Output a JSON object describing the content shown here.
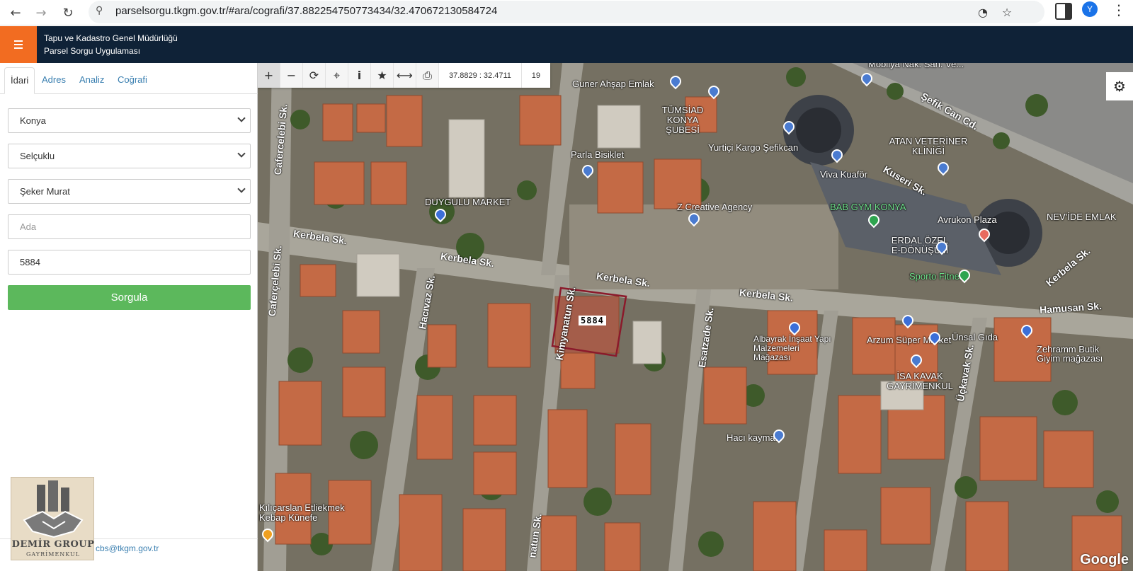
{
  "browser": {
    "url": "parselsorgu.tkgm.gov.tr/#ara/cografi/37.882254750773434/32.470672130584724",
    "back_icon": "←",
    "forward_icon": "→",
    "reload_icon": "↻",
    "site_info_icon": "⚲",
    "gauge_icon": "◔",
    "star_icon": "☆",
    "avatar_letter": "Y",
    "more_icon": "⋮"
  },
  "app": {
    "title_line1": "Tapu ve Kadastro Genel Müdürlüğü",
    "title_line2": "Parsel Sorgu Uygulaması",
    "accent_color": "#f26c21",
    "header_color": "#0f2237"
  },
  "sidebar": {
    "tabs": [
      {
        "label": "İdari",
        "active": true
      },
      {
        "label": "Adres",
        "active": false
      },
      {
        "label": "Analiz",
        "active": false
      },
      {
        "label": "Coğrafi",
        "active": false
      }
    ],
    "province": "Konya",
    "district": "Selçuklu",
    "neighborhood": "Şeker Murat",
    "ada_placeholder": "Ada",
    "parsel_value": "5884",
    "submit_label": "Sorgula",
    "submit_color": "#5cb85c",
    "footer_email": "cbs@tkgm.gov.tr",
    "logo_line1": "DEMİR GROUP",
    "logo_line2": "GAYRİMENKUL"
  },
  "map": {
    "toolbar": {
      "zoom_in": "+",
      "zoom_out": "−",
      "refresh": "⟳",
      "locate": "⌖",
      "info": "i",
      "favorite": "★",
      "measure": "⟷",
      "print": "⎙",
      "coordinates": "37.8829 : 32.4711",
      "zoom_level": "19"
    },
    "settings_icon": "⚙",
    "parcel_label": "5884",
    "streets": [
      "Şefik Can Cd.",
      "Kerbela Sk.",
      "Kerbela Sk.",
      "Kerbela Sk.",
      "Kerbela Sk.",
      "Kerbela Sk.",
      "Cafercelebi Sk.",
      "Caferçelebi Sk.",
      "Hacıvaz Sk.",
      "Kimyanatun Sk.",
      "Esatzade Sk.",
      "Kuseri Sk.",
      "Hamusan Sk.",
      "Üçkavak Sk.",
      "natun Sk."
    ],
    "pois": [
      "Guner Ahşap Emlak",
      "TÜMSİAD KONYA ŞUBESİ",
      "Parla Bisiklet",
      "Yurtiçi Kargo Şefikcan",
      "ATAN VETERİNER KLİNİĞİ",
      "Viva Kuaför",
      "DUYGULU MARKET",
      "Z Creative Agency",
      "BAB GYM KONYA",
      "Avrukon Plaza",
      "NEV'İDE EMLAK",
      "ERDAL ÖZEL E-DÖNÜŞÜM",
      "Sporto Fitness",
      "Albayrak İnşaat Yapı Malzemeleri Mağazası",
      "Arzum Süper Market",
      "Ünsal Gıda",
      "Zehramm Butik Giyim mağazası",
      "İSA KAVAK GAYRİMENKUL",
      "Hacı kaymak",
      "Kılıçarslan Etliekmek Kebap Künefe",
      "Mobilya Nak. San. Ve..."
    ],
    "attribution": "Google",
    "parcel_border_color": "#8b1a2b"
  }
}
